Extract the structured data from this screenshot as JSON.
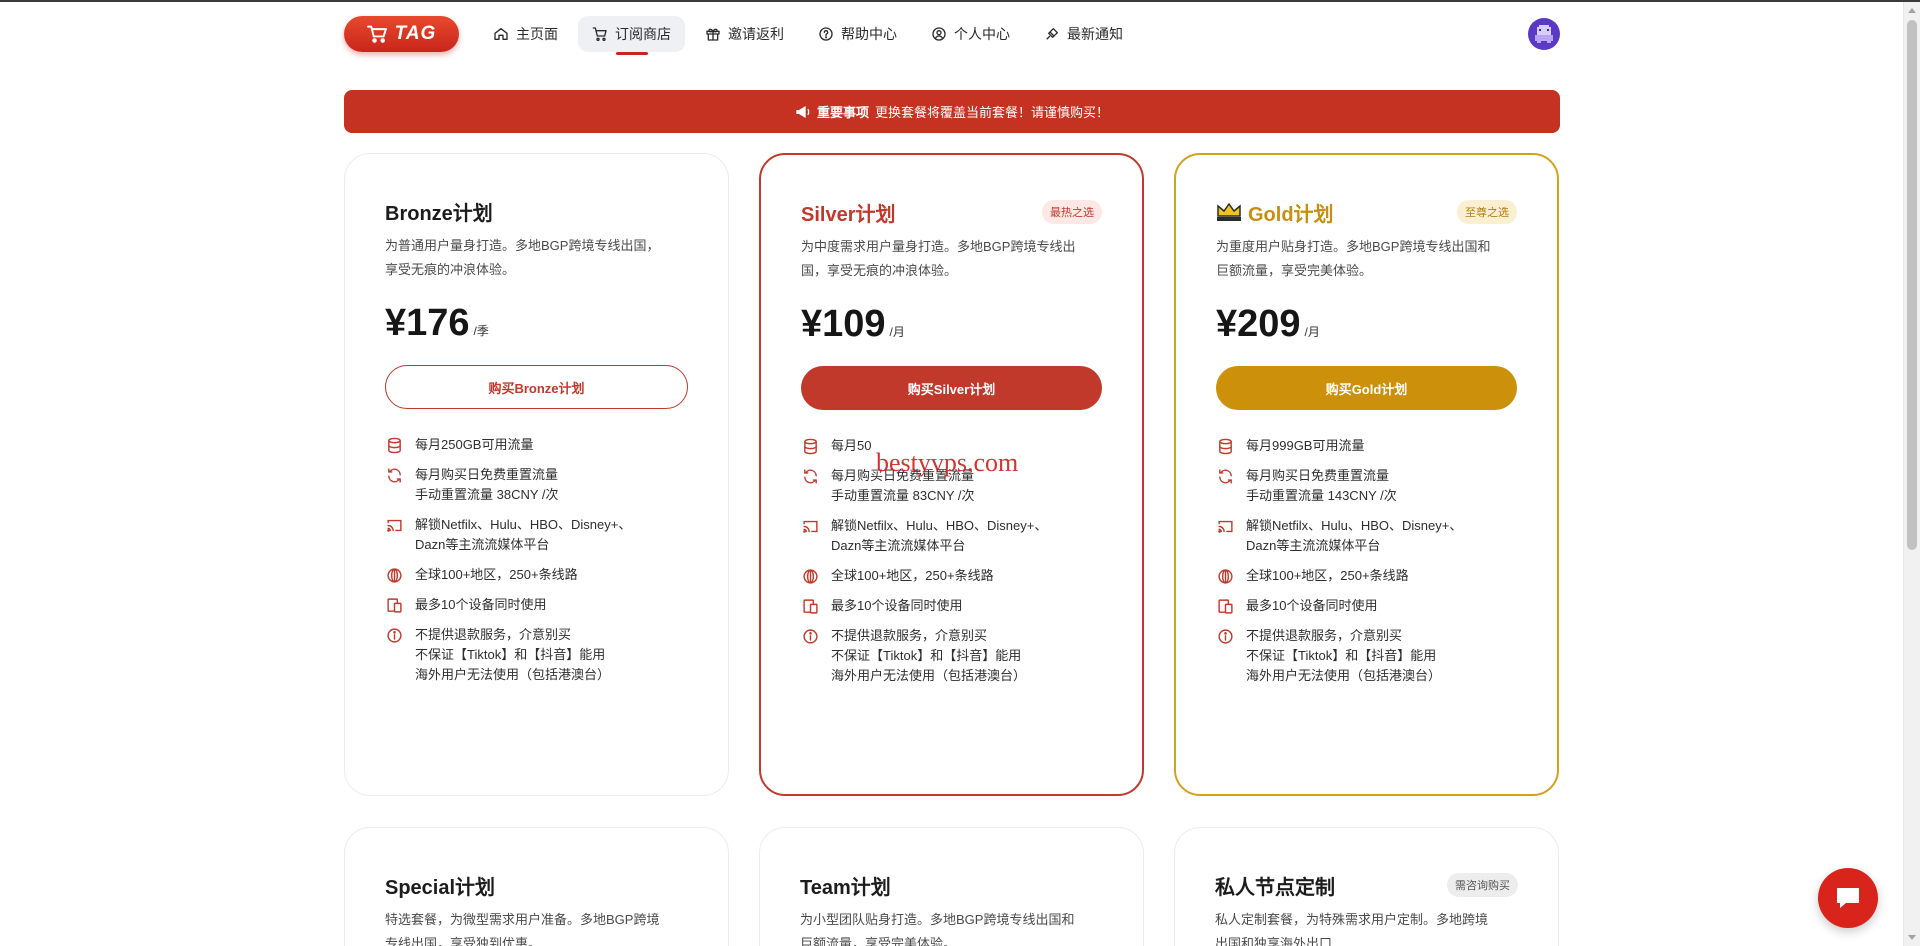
{
  "header": {
    "logo_text": "TAG",
    "nav": [
      {
        "label": "主页面",
        "icon": "home-icon"
      },
      {
        "label": "订阅商店",
        "icon": "cart-icon",
        "active": true
      },
      {
        "label": "邀请返利",
        "icon": "gift-icon"
      },
      {
        "label": "帮助中心",
        "icon": "help-icon"
      },
      {
        "label": "个人中心",
        "icon": "user-icon"
      },
      {
        "label": "最新通知",
        "icon": "bell-icon"
      }
    ]
  },
  "notice": {
    "icon": "megaphone-icon",
    "bold": "重要事项",
    "text": "更换套餐将覆盖当前套餐！请谨慎购买！"
  },
  "plans": [
    {
      "name": "Bronze计划",
      "badge": "",
      "desc1": "为普通用户量身打造。多地BGP跨境专线出国，",
      "desc2": "享受无痕的冲浪体验。",
      "price": "¥176",
      "unit": "/季",
      "button": "购买Bronze计划",
      "features": [
        {
          "lines": [
            "每月250GB可用流量"
          ],
          "icon": "database-icon"
        },
        {
          "lines": [
            "每月购买日免费重置流量",
            "手动重置流量 38CNY /次"
          ],
          "icon": "refresh-icon"
        },
        {
          "lines": [
            "解锁Netfilx、Hulu、HBO、Disney+、",
            "Dazn等主流流媒体平台"
          ],
          "icon": "cast-icon"
        },
        {
          "lines": [
            "全球100+地区，250+条线路"
          ],
          "icon": "globe-icon"
        },
        {
          "lines": [
            "最多10个设备同时使用"
          ],
          "icon": "devices-icon"
        },
        {
          "lines": [
            "不提供退款服务，介意别买",
            "不保证【Tiktok】和【抖音】能用",
            "海外用户无法使用（包括港澳台）"
          ],
          "icon": "info-icon"
        }
      ]
    },
    {
      "name": "Silver计划",
      "badge": "最热之选",
      "desc1": "为中度需求用户量身打造。多地BGP跨境专线出",
      "desc2": "国，享受无痕的冲浪体验。",
      "price": "¥109",
      "unit": "/月",
      "button": "购买Silver计划",
      "features": [
        {
          "lines": [
            "每月50"
          ],
          "icon": "database-icon"
        },
        {
          "lines": [
            "每月购买日免费重置流量",
            "手动重置流量 83CNY /次"
          ],
          "icon": "refresh-icon"
        },
        {
          "lines": [
            "解锁Netfilx、Hulu、HBO、Disney+、",
            "Dazn等主流流媒体平台"
          ],
          "icon": "cast-icon"
        },
        {
          "lines": [
            "全球100+地区，250+条线路"
          ],
          "icon": "globe-icon"
        },
        {
          "lines": [
            "最多10个设备同时使用"
          ],
          "icon": "devices-icon"
        },
        {
          "lines": [
            "不提供退款服务，介意别买",
            "不保证【Tiktok】和【抖音】能用",
            "海外用户无法使用（包括港澳台）"
          ],
          "icon": "info-icon"
        }
      ]
    },
    {
      "name": "Gold计划",
      "badge": "至尊之选",
      "desc1": "为重度用户贴身打造。多地BGP跨境专线出国和",
      "desc2": "巨额流量，享受完美体验。",
      "price": "¥209",
      "unit": "/月",
      "button": "购买Gold计划",
      "features": [
        {
          "lines": [
            "每月999GB可用流量"
          ],
          "icon": "database-icon"
        },
        {
          "lines": [
            "每月购买日免费重置流量",
            "手动重置流量 143CNY /次"
          ],
          "icon": "refresh-icon"
        },
        {
          "lines": [
            "解锁Netfilx、Hulu、HBO、Disney+、",
            "Dazn等主流流媒体平台"
          ],
          "icon": "cast-icon"
        },
        {
          "lines": [
            "全球100+地区，250+条线路"
          ],
          "icon": "globe-icon"
        },
        {
          "lines": [
            "最多10个设备同时使用"
          ],
          "icon": "devices-icon"
        },
        {
          "lines": [
            "不提供退款服务，介意别买",
            "不保证【Tiktok】和【抖音】能用",
            "海外用户无法使用（包括港澳台）"
          ],
          "icon": "info-icon"
        }
      ]
    }
  ],
  "plans_row2": [
    {
      "name": "Special计划",
      "badge": "",
      "desc1": "特选套餐，为微型需求用户准备。多地BGP跨境",
      "desc2": "专线出国，享受独到优惠。"
    },
    {
      "name": "Team计划",
      "badge": "",
      "desc1": "为小型团队贴身打造。多地BGP跨境专线出国和",
      "desc2": "巨额流量，享受完美体验。"
    },
    {
      "name": "私人节点定制",
      "badge": "需咨询购买",
      "desc1": "私人定制套餐，为特殊需求用户定制。多地跨境",
      "desc2": "出国和独享海外出口"
    }
  ],
  "watermark": "bestyvps.com",
  "colors": {
    "accent": "#c1392b",
    "gold": "#cc900b",
    "notice": "#c63221"
  }
}
